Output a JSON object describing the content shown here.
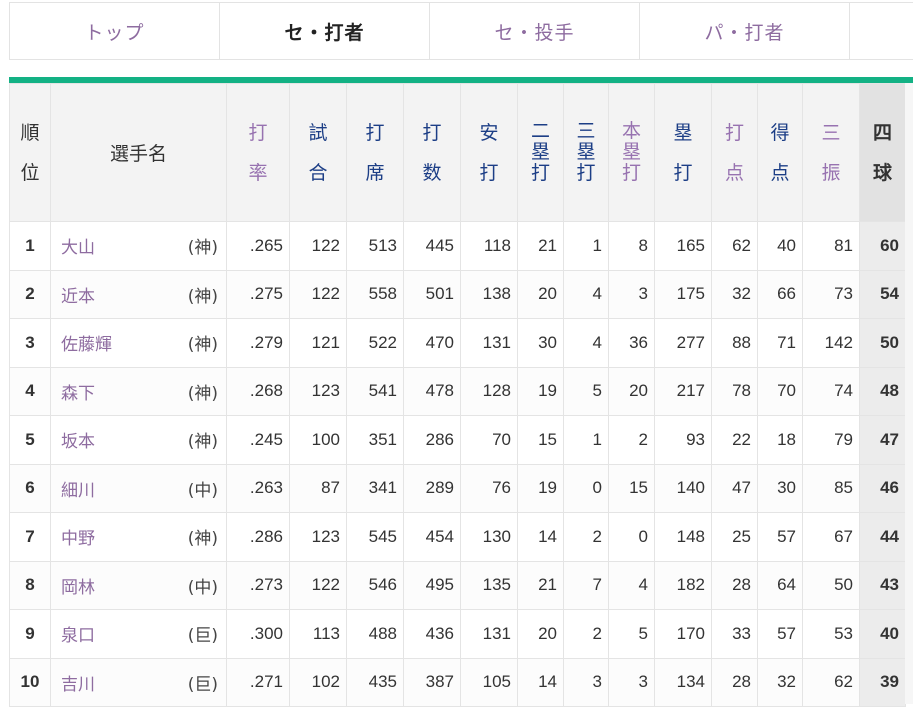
{
  "tabs": [
    {
      "label": "トップ",
      "active": false
    },
    {
      "label": "セ・打者",
      "active": true
    },
    {
      "label": "セ・投手",
      "active": false
    },
    {
      "label": "パ・打者",
      "active": false
    },
    {
      "label": "",
      "active": false
    }
  ],
  "headers": {
    "rank": [
      "順",
      "位"
    ],
    "name": "選手名",
    "avg": [
      "打",
      "率"
    ],
    "games": [
      "試",
      "合"
    ],
    "pa": [
      "打",
      "席"
    ],
    "ab": [
      "打",
      "数"
    ],
    "hits": [
      "安",
      "打"
    ],
    "doubles": [
      "二",
      "塁",
      "打"
    ],
    "triples": [
      "三",
      "塁",
      "打"
    ],
    "hr": [
      "本",
      "塁",
      "打"
    ],
    "tb": [
      "塁",
      "打"
    ],
    "rbi": [
      "打",
      "点"
    ],
    "runs": [
      "得",
      "点"
    ],
    "so": [
      "三",
      "振"
    ],
    "bb": [
      "四",
      "球"
    ]
  },
  "rows": [
    {
      "rank": "1",
      "name": "大山",
      "team": "(神)",
      "avg": ".265",
      "games": "122",
      "pa": "513",
      "ab": "445",
      "hits": "118",
      "doubles": "21",
      "triples": "1",
      "hr": "8",
      "tb": "165",
      "rbi": "62",
      "runs": "40",
      "so": "81",
      "bb": "60"
    },
    {
      "rank": "2",
      "name": "近本",
      "team": "(神)",
      "avg": ".275",
      "games": "122",
      "pa": "558",
      "ab": "501",
      "hits": "138",
      "doubles": "20",
      "triples": "4",
      "hr": "3",
      "tb": "175",
      "rbi": "32",
      "runs": "66",
      "so": "73",
      "bb": "54"
    },
    {
      "rank": "3",
      "name": "佐藤輝",
      "team": "(神)",
      "avg": ".279",
      "games": "121",
      "pa": "522",
      "ab": "470",
      "hits": "131",
      "doubles": "30",
      "triples": "4",
      "hr": "36",
      "tb": "277",
      "rbi": "88",
      "runs": "71",
      "so": "142",
      "bb": "50"
    },
    {
      "rank": "4",
      "name": "森下",
      "team": "(神)",
      "avg": ".268",
      "games": "123",
      "pa": "541",
      "ab": "478",
      "hits": "128",
      "doubles": "19",
      "triples": "5",
      "hr": "20",
      "tb": "217",
      "rbi": "78",
      "runs": "70",
      "so": "74",
      "bb": "48"
    },
    {
      "rank": "5",
      "name": "坂本",
      "team": "(神)",
      "avg": ".245",
      "games": "100",
      "pa": "351",
      "ab": "286",
      "hits": "70",
      "doubles": "15",
      "triples": "1",
      "hr": "2",
      "tb": "93",
      "rbi": "22",
      "runs": "18",
      "so": "79",
      "bb": "47"
    },
    {
      "rank": "6",
      "name": "細川",
      "team": "(中)",
      "avg": ".263",
      "games": "87",
      "pa": "341",
      "ab": "289",
      "hits": "76",
      "doubles": "19",
      "triples": "0",
      "hr": "15",
      "tb": "140",
      "rbi": "47",
      "runs": "30",
      "so": "85",
      "bb": "46"
    },
    {
      "rank": "7",
      "name": "中野",
      "team": "(神)",
      "avg": ".286",
      "games": "123",
      "pa": "545",
      "ab": "454",
      "hits": "130",
      "doubles": "14",
      "triples": "2",
      "hr": "0",
      "tb": "148",
      "rbi": "25",
      "runs": "57",
      "so": "67",
      "bb": "44"
    },
    {
      "rank": "8",
      "name": "岡林",
      "team": "(中)",
      "avg": ".273",
      "games": "122",
      "pa": "546",
      "ab": "495",
      "hits": "135",
      "doubles": "21",
      "triples": "7",
      "hr": "4",
      "tb": "182",
      "rbi": "28",
      "runs": "64",
      "so": "50",
      "bb": "43"
    },
    {
      "rank": "9",
      "name": "泉口",
      "team": "(巨)",
      "avg": ".300",
      "games": "113",
      "pa": "488",
      "ab": "436",
      "hits": "131",
      "doubles": "20",
      "triples": "2",
      "hr": "5",
      "tb": "170",
      "rbi": "33",
      "runs": "57",
      "so": "53",
      "bb": "40"
    },
    {
      "rank": "10",
      "name": "吉川",
      "team": "(巨)",
      "avg": ".271",
      "games": "102",
      "pa": "435",
      "ab": "387",
      "hits": "105",
      "doubles": "14",
      "triples": "3",
      "hr": "3",
      "tb": "134",
      "rbi": "28",
      "runs": "32",
      "so": "62",
      "bb": "39"
    }
  ],
  "colors": {
    "accent": "#13b184",
    "link": "#8e6ca0",
    "header_blue": "#1c3e86",
    "header_purple": "#9772b0"
  }
}
